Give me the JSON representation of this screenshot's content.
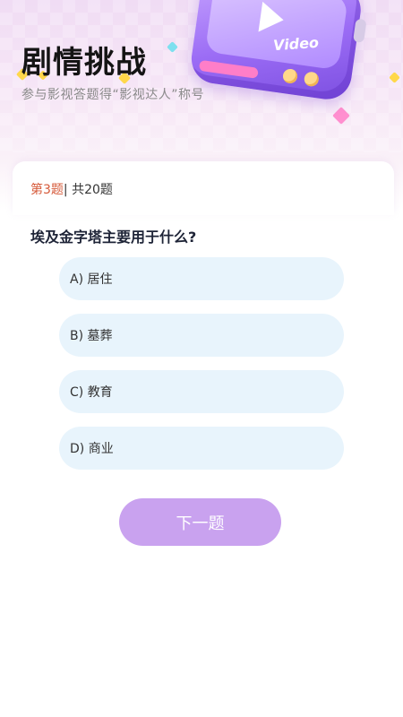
{
  "header": {
    "title": "剧情挑战",
    "subtitle": "参与影视答题得“影视达人”称号",
    "illustration_label": "Video"
  },
  "quiz": {
    "progress_current": "第3题",
    "progress_separator": "|",
    "progress_total": " 共20题",
    "question": "埃及金字塔主要用于什么?",
    "options": [
      {
        "label": "A) 居住"
      },
      {
        "label": "B) 墓葬"
      },
      {
        "label": "C) 教育"
      },
      {
        "label": "D) 商业"
      }
    ],
    "next_label": "下一题"
  },
  "colors": {
    "accent_button": "#c9a2ef",
    "option_bg": "#e8f4fc",
    "progress_highlight": "#d65a3a",
    "hero_bg": "#f0dcf4"
  }
}
